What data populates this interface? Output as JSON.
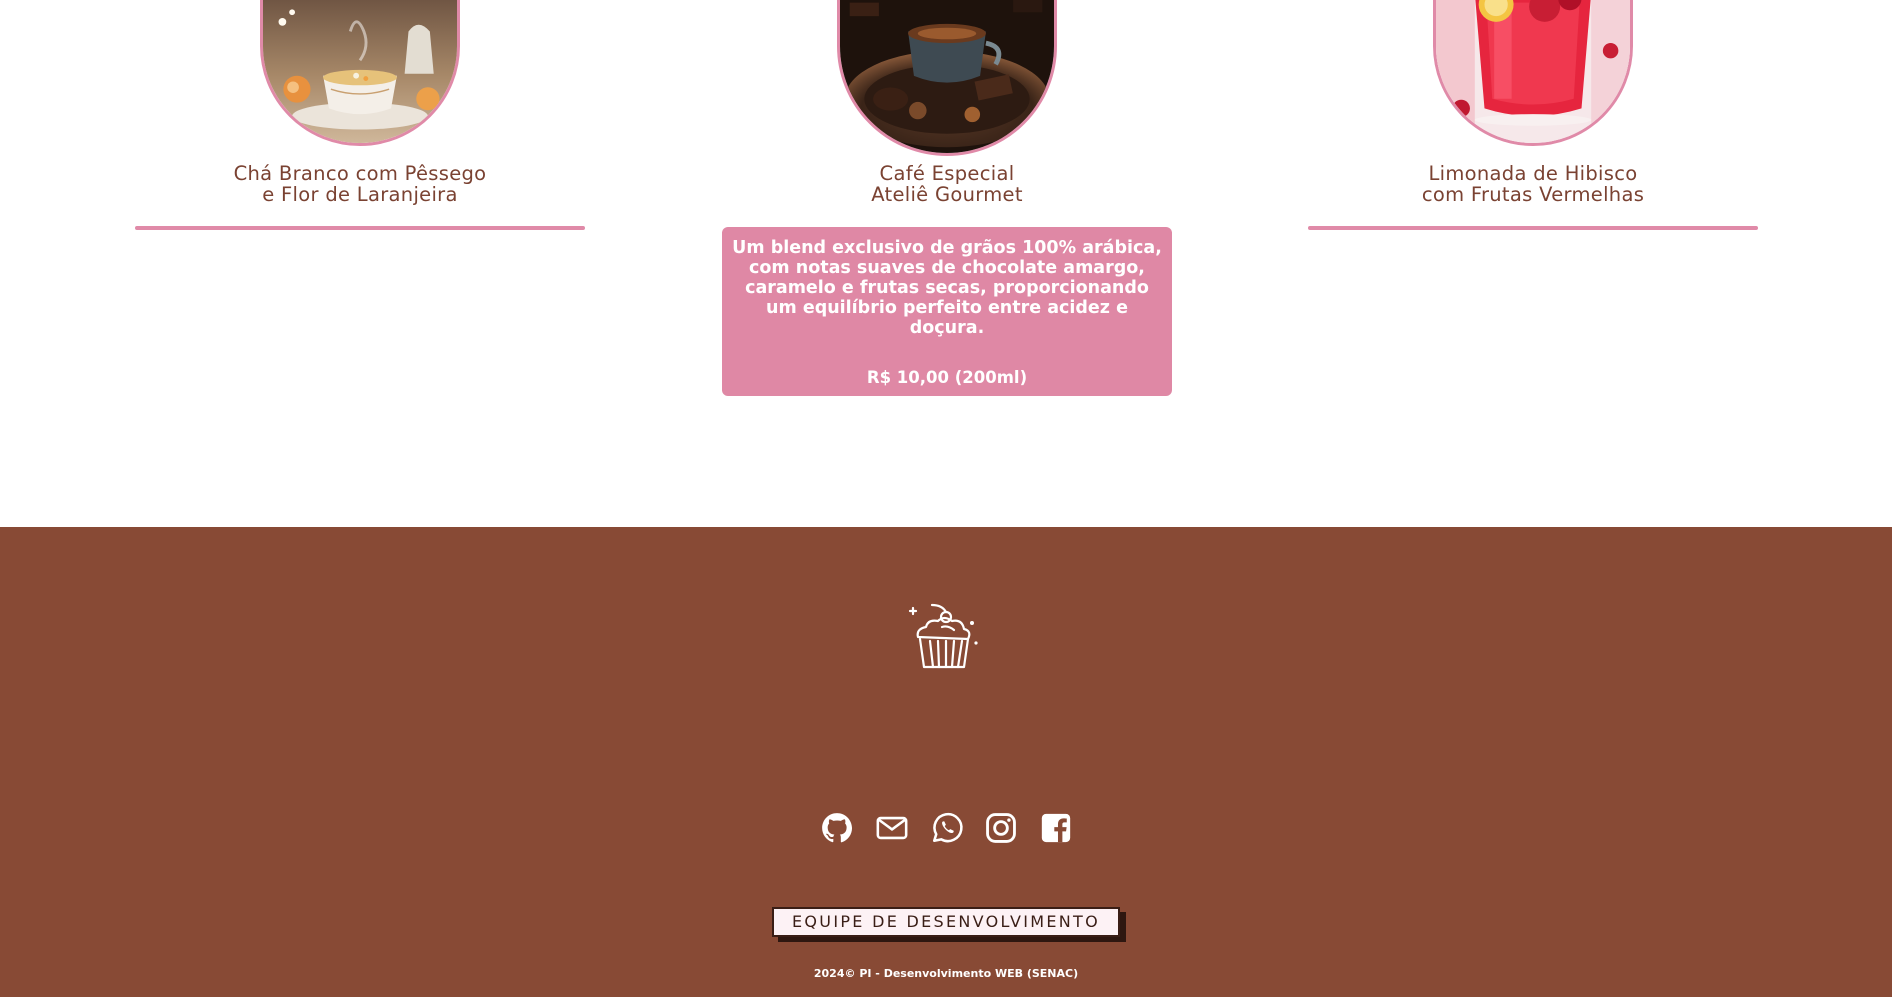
{
  "menu": {
    "cards": [
      {
        "title_line1": "Chá Branco com Pêssego",
        "title_line2": "e Flor de Laranjeira",
        "image_alt": "cup of white tea with peach and orange blossom"
      },
      {
        "title_line1": "Café Especial",
        "title_line2": "Ateliê Gourmet",
        "image_alt": "cup of gourmet coffee with chocolates",
        "description": "Um blend exclusivo de grãos 100% arábica, com notas suaves de chocolate amargo, caramelo e frutas secas, proporcionando um equilíbrio perfeito entre acidez e doçura.",
        "price": "R$ 10,00 (200ml)"
      },
      {
        "title_line1": "Limonada de Hibisco",
        "title_line2": "com Frutas Vermelhas",
        "image_alt": "glass of hibiscus lemonade with red berries"
      }
    ]
  },
  "footer": {
    "logo_icon": "cupcake-icon",
    "social_icons": [
      "github-icon",
      "mail-icon",
      "whatsapp-icon",
      "instagram-icon",
      "facebook-icon"
    ],
    "team_button_label": "EQUIPE DE DESENVOLVIMENTO",
    "copyright": "2024© PI - Desenvolvimento WEB (SENAC)"
  },
  "colors": {
    "accent_pink": "#df88a5",
    "title_brown": "#7a4232",
    "footer_brown": "#884a35",
    "button_bg": "#fdf2f5"
  }
}
